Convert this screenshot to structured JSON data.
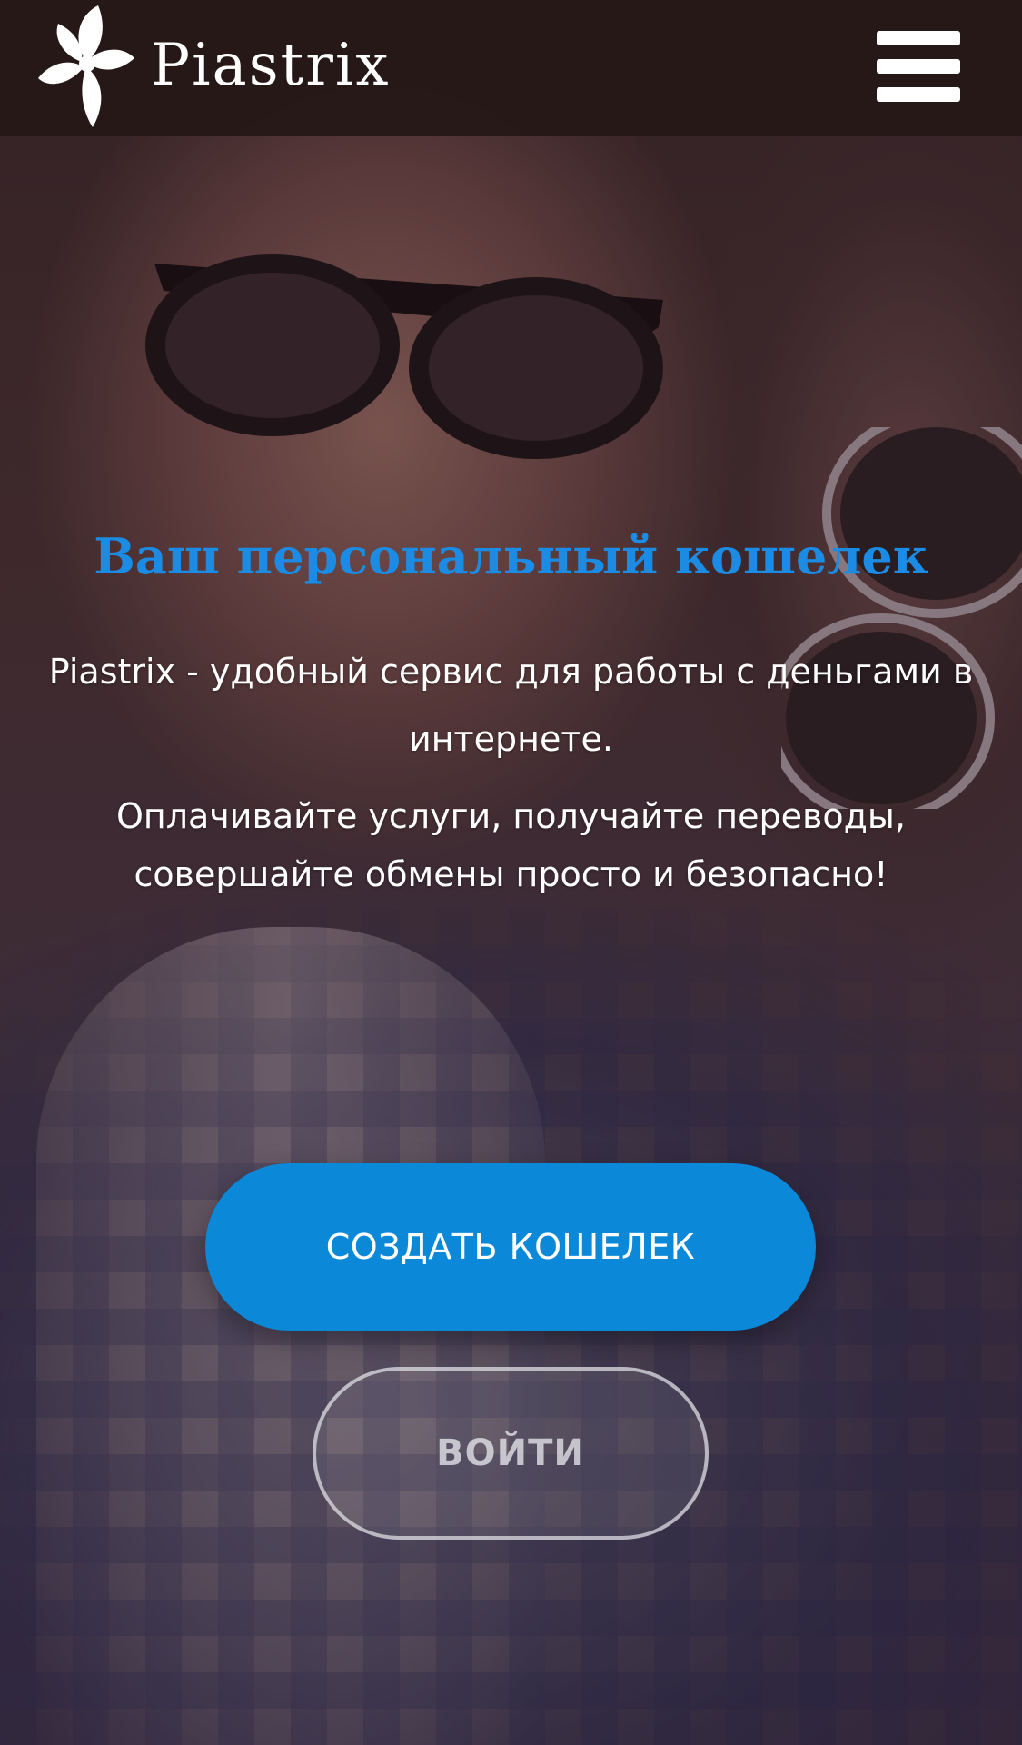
{
  "header": {
    "logo_text": "Piastrix",
    "logo_icon": "flower-logo-icon",
    "menu_icon": "hamburger-menu-icon"
  },
  "hero": {
    "headline": "Ваш персональный кошелек",
    "intro_line1": "Piastrix - удобный сервис для работы с деньгами в",
    "intro_line2": "интернете.",
    "body_line1": "Оплачивайте услуги, получайте переводы,",
    "body_line2": "совершайте обмены просто и безопасно!"
  },
  "actions": {
    "create_wallet_label": "СОЗДАТЬ КОШЕЛЕК",
    "login_label": "ВОЙТИ"
  },
  "colors": {
    "accent": "#1b8be3",
    "button_primary": "#0b88d8",
    "header_bg": "#241816",
    "text_light": "#ffffff"
  }
}
